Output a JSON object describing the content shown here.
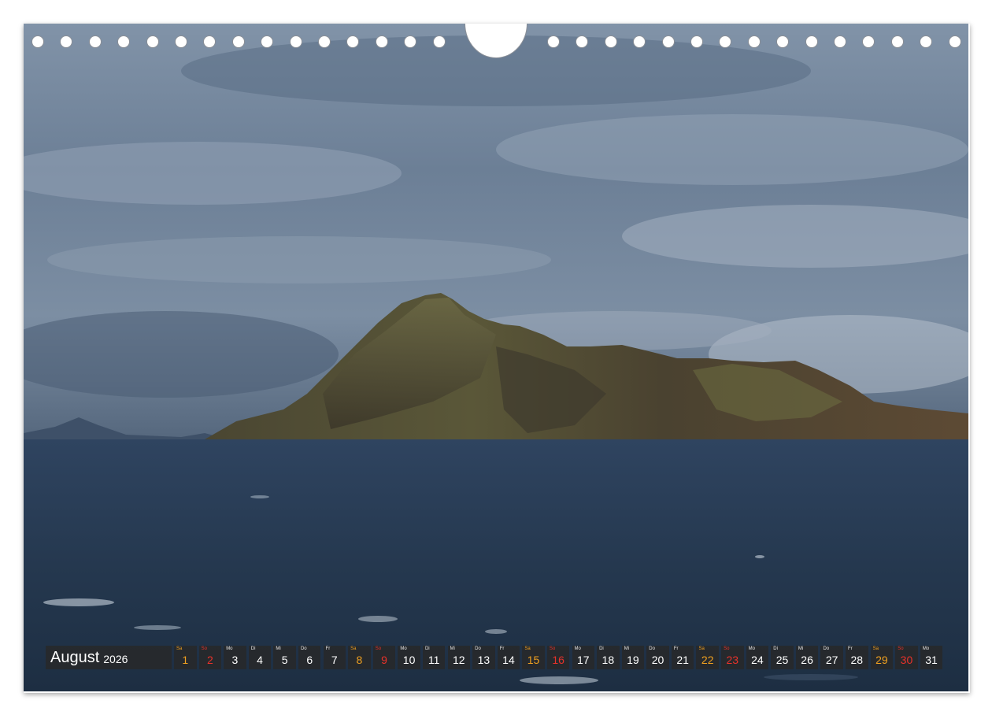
{
  "calendar": {
    "month": "August",
    "year": "2026",
    "days": [
      {
        "dow": "Sa",
        "num": "1",
        "type": "sat"
      },
      {
        "dow": "So",
        "num": "2",
        "type": "sun"
      },
      {
        "dow": "Mo",
        "num": "3",
        "type": "week"
      },
      {
        "dow": "Di",
        "num": "4",
        "type": "week"
      },
      {
        "dow": "Mi",
        "num": "5",
        "type": "week"
      },
      {
        "dow": "Do",
        "num": "6",
        "type": "week"
      },
      {
        "dow": "Fr",
        "num": "7",
        "type": "week"
      },
      {
        "dow": "Sa",
        "num": "8",
        "type": "sat"
      },
      {
        "dow": "So",
        "num": "9",
        "type": "sun"
      },
      {
        "dow": "Mo",
        "num": "10",
        "type": "week"
      },
      {
        "dow": "Di",
        "num": "11",
        "type": "week"
      },
      {
        "dow": "Mi",
        "num": "12",
        "type": "week"
      },
      {
        "dow": "Do",
        "num": "13",
        "type": "week"
      },
      {
        "dow": "Fr",
        "num": "14",
        "type": "week"
      },
      {
        "dow": "Sa",
        "num": "15",
        "type": "sat"
      },
      {
        "dow": "So",
        "num": "16",
        "type": "sun"
      },
      {
        "dow": "Mo",
        "num": "17",
        "type": "week"
      },
      {
        "dow": "Di",
        "num": "18",
        "type": "week"
      },
      {
        "dow": "Mi",
        "num": "19",
        "type": "week"
      },
      {
        "dow": "Do",
        "num": "20",
        "type": "week"
      },
      {
        "dow": "Fr",
        "num": "21",
        "type": "week"
      },
      {
        "dow": "Sa",
        "num": "22",
        "type": "sat"
      },
      {
        "dow": "So",
        "num": "23",
        "type": "sun"
      },
      {
        "dow": "Mo",
        "num": "24",
        "type": "week"
      },
      {
        "dow": "Di",
        "num": "25",
        "type": "week"
      },
      {
        "dow": "Mi",
        "num": "26",
        "type": "week"
      },
      {
        "dow": "Do",
        "num": "27",
        "type": "week"
      },
      {
        "dow": "Fr",
        "num": "28",
        "type": "week"
      },
      {
        "dow": "Sa",
        "num": "29",
        "type": "sat"
      },
      {
        "dow": "So",
        "num": "30",
        "type": "sun"
      },
      {
        "dow": "Mo",
        "num": "31",
        "type": "week"
      }
    ]
  },
  "colors": {
    "weekday": "#ffffff",
    "saturday": "#f0a020",
    "sunday": "#e8322a",
    "sky": "#5d6f85",
    "sea": "#26394f",
    "island": "#4f4a36"
  },
  "binding": {
    "left_holes": 15,
    "right_holes": 15
  }
}
